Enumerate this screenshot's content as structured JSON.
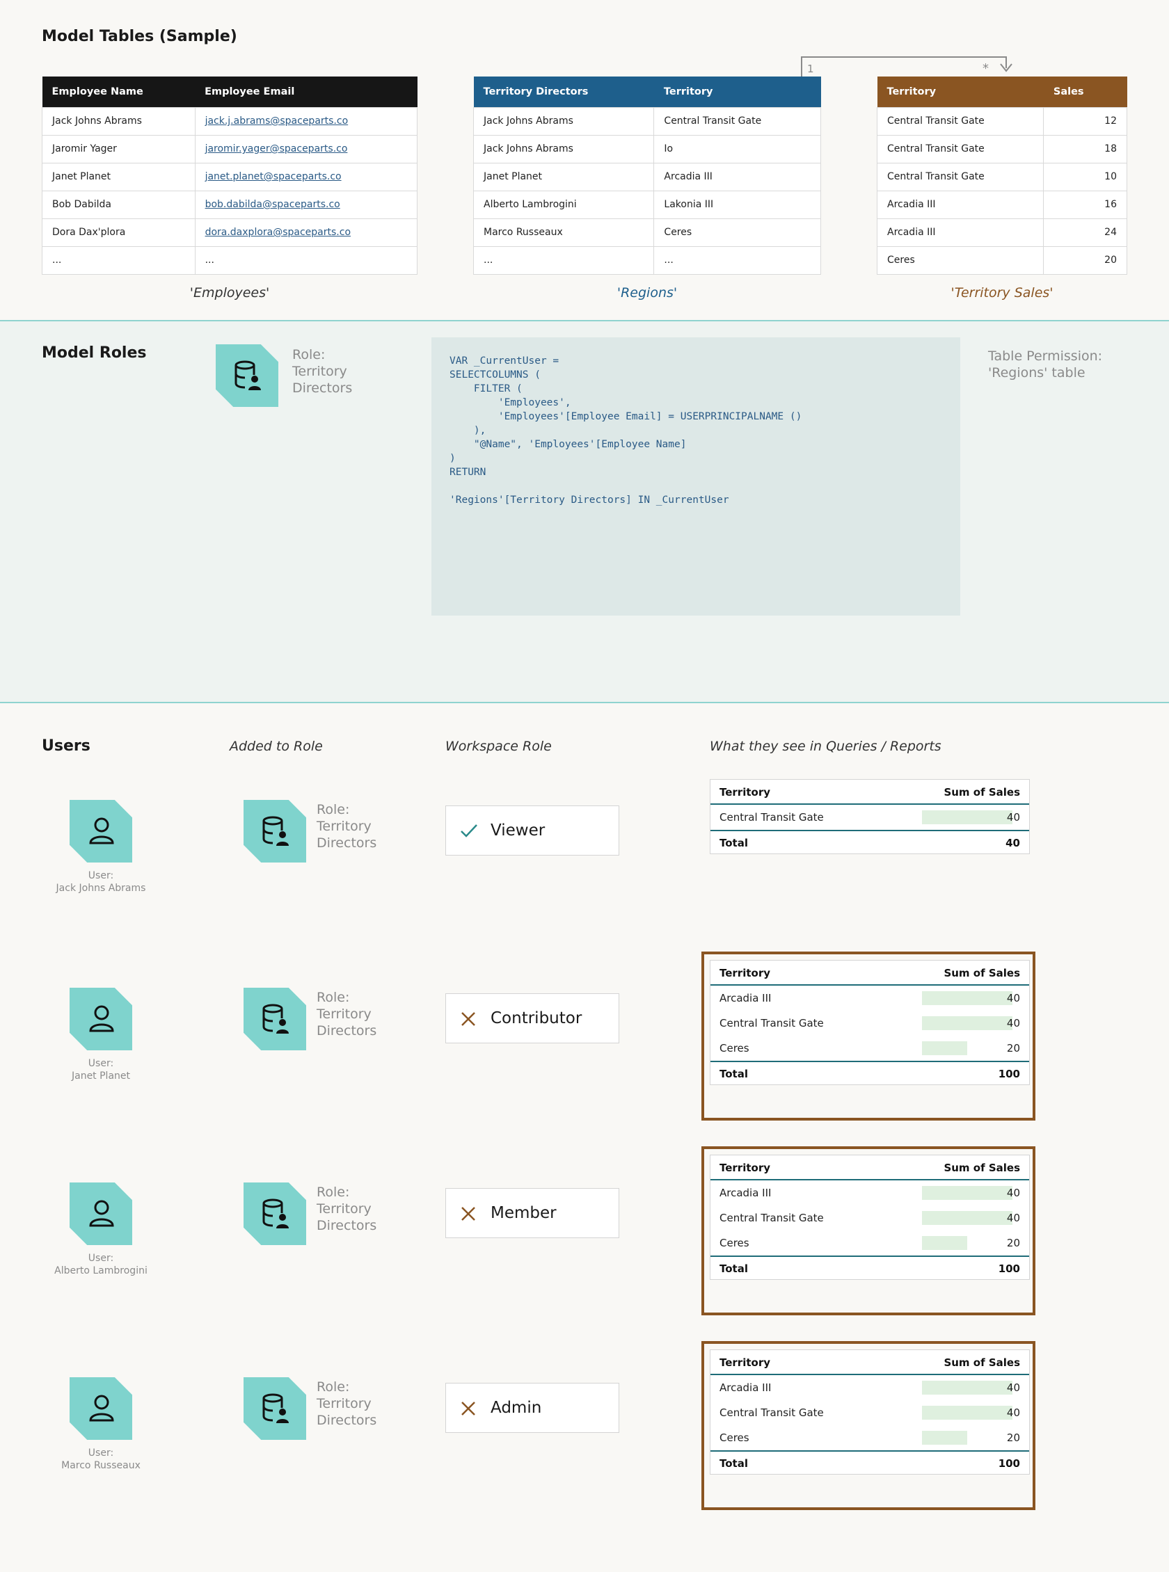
{
  "model_tables": {
    "title": "Model Tables (Sample)",
    "employees": {
      "headers": [
        "Employee Name",
        "Employee Email"
      ],
      "rows": [
        [
          "Jack Johns Abrams",
          "jack.j.abrams@spaceparts.co"
        ],
        [
          "Jaromir Yager",
          "jaromir.yager@spaceparts.co"
        ],
        [
          "Janet Planet",
          "janet.planet@spaceparts.co"
        ],
        [
          "Bob Dabilda",
          "bob.dabilda@spaceparts.co"
        ],
        [
          "Dora Dax'plora",
          "dora.daxplora@spaceparts.co"
        ],
        [
          "...",
          "..."
        ]
      ],
      "caption": "'Employees'"
    },
    "regions": {
      "headers": [
        "Territory Directors",
        "Territory"
      ],
      "rows": [
        [
          "Jack Johns Abrams",
          "Central Transit Gate"
        ],
        [
          "Jack Johns Abrams",
          "Io"
        ],
        [
          "Janet Planet",
          "Arcadia III"
        ],
        [
          "Alberto Lambrogini",
          "Lakonia III"
        ],
        [
          "Marco Russeaux",
          "Ceres"
        ],
        [
          "...",
          "..."
        ]
      ],
      "caption": "'Regions'"
    },
    "territory_sales": {
      "headers": [
        "Territory",
        "Sales"
      ],
      "rows": [
        [
          "Central Transit Gate",
          "12"
        ],
        [
          "Central Transit Gate",
          "18"
        ],
        [
          "Central Transit Gate",
          "10"
        ],
        [
          "Arcadia III",
          "16"
        ],
        [
          "Arcadia III",
          "24"
        ],
        [
          "Ceres",
          "20"
        ]
      ],
      "caption": "'Territory Sales'"
    },
    "relationship": {
      "from_cardinality": "1",
      "to_cardinality": "*"
    }
  },
  "model_roles": {
    "title": "Model Roles",
    "role_label": [
      "Role:",
      "Territory",
      "Directors"
    ],
    "dax_lines": [
      "VAR _CurrentUser =",
      "SELECTCOLUMNS (",
      "    FILTER (",
      "        'Employees',",
      "        'Employees'[Employee Email] = USERPRINCIPALNAME ()",
      "    ),",
      "    \"@Name\", 'Employees'[Employee Name]",
      ")",
      "RETURN",
      "",
      "'Regions'[Territory Directors] IN _CurrentUser"
    ],
    "table_permission": [
      "Table Permission:",
      "'Regions' table"
    ]
  },
  "users_section": {
    "title": "Users",
    "col_added": "Added to Role",
    "col_workspace": "Workspace Role",
    "col_see": "What they see in Queries / Reports",
    "result_headers": [
      "Territory",
      "Sum of Sales"
    ],
    "total_label": "Total",
    "users": [
      {
        "label": [
          "User:",
          "Jack Johns Abrams"
        ],
        "role": [
          "Role:",
          "Territory",
          "Directors"
        ],
        "workspace_role": "Viewer",
        "workspace_status": "allowed",
        "results": [
          [
            "Central Transit Gate",
            "40"
          ]
        ],
        "total": "40"
      },
      {
        "label": [
          "User:",
          "Janet Planet"
        ],
        "role": [
          "Role:",
          "Territory",
          "Directors"
        ],
        "workspace_role": "Contributor",
        "workspace_status": "bypassed",
        "results": [
          [
            "Arcadia III",
            "40"
          ],
          [
            "Central Transit Gate",
            "40"
          ],
          [
            "Ceres",
            "20"
          ]
        ],
        "total": "100"
      },
      {
        "label": [
          "User:",
          "Alberto Lambrogini"
        ],
        "role": [
          "Role:",
          "Territory",
          "Directors"
        ],
        "workspace_role": "Member",
        "workspace_status": "bypassed",
        "results": [
          [
            "Arcadia III",
            "40"
          ],
          [
            "Central Transit Gate",
            "40"
          ],
          [
            "Ceres",
            "20"
          ]
        ],
        "total": "100"
      },
      {
        "label": [
          "User:",
          "Marco Russeaux"
        ],
        "role": [
          "Role:",
          "Territory",
          "Directors"
        ],
        "workspace_role": "Admin",
        "workspace_status": "bypassed",
        "results": [
          [
            "Arcadia III",
            "40"
          ],
          [
            "Central Transit Gate",
            "40"
          ],
          [
            "Ceres",
            "20"
          ]
        ],
        "total": "100"
      }
    ]
  },
  "colors": {
    "employees_header": "#161616",
    "regions_header": "#1e5f8c",
    "sales_header": "#8a5522",
    "teal_icon": "#7fd3cd",
    "check": "#2a8a8a",
    "cross": "#8a5522",
    "bar": "#dff0df"
  },
  "icons": {
    "role": "database-user-icon",
    "user": "user-icon",
    "allowed": "check-icon",
    "bypassed": "cross-icon"
  }
}
